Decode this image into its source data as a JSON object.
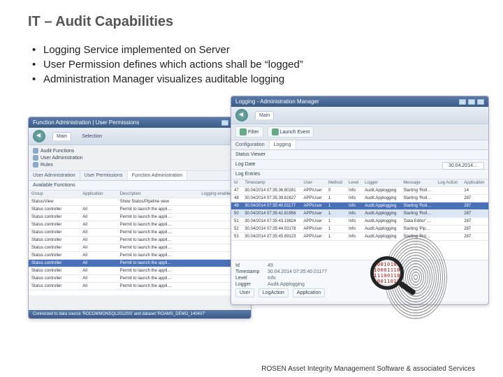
{
  "title": "IT – Audit Capabilities",
  "bullets": [
    "Logging Service implemented on Server",
    "User Permission defines which actions shall be “logged”",
    "Administration Manager visualizes auditable logging"
  ],
  "win1": {
    "title": "Function Administration | User Permissions",
    "ribbon": {
      "tab_main": "Main",
      "tab_selection": "Selection"
    },
    "side": [
      {
        "label": "Audit Functions"
      },
      {
        "label": "User Administration"
      },
      {
        "label": "Rules"
      }
    ],
    "subtabs": [
      "User Administration",
      "User Permissions",
      "Function Administration"
    ],
    "pane_label": "Available Functions",
    "columns": [
      "Group",
      "Application",
      "Description",
      "Logging enabled"
    ],
    "rows": [
      [
        "Status/View",
        "",
        "Show Status/Pipeline view",
        ""
      ],
      [
        "Status controller",
        "All",
        "Permit to launch the appli…",
        ""
      ],
      [
        "Status controller",
        "All",
        "Permit to launch the appli…",
        ""
      ],
      [
        "Status controller",
        "All",
        "Permit to launch the appli…",
        ""
      ],
      [
        "Status controller",
        "All",
        "Permit to launch the appli…",
        ""
      ],
      [
        "Status controller",
        "All",
        "Permit to launch the appli…",
        ""
      ],
      [
        "Status controller",
        "All",
        "Permit to launch the appli…",
        ""
      ],
      [
        "Status controller",
        "All",
        "Permit to launch the appli…",
        ""
      ],
      [
        "Status controller",
        "All",
        "Permit to launch the appli…",
        ""
      ],
      [
        "Status controller",
        "All",
        "Permit to launch the appli…",
        ""
      ],
      [
        "Status controller",
        "All",
        "Permit to launch the appli…",
        ""
      ],
      [
        "Status controller",
        "All",
        "Permit to launch the appli…",
        ""
      ]
    ],
    "sel_index": 8,
    "statusbar": "Connected to data source 'ROCOMMONSQL2012SS' and dataset 'ROAMS_DEMO_140407'"
  },
  "win2": {
    "title": "Logging - Administration Manager",
    "ribbon": {
      "tab_main": "Main"
    },
    "tool": {
      "filter": "Filter",
      "launch": "Launch Event",
      "configuration": "Configuration",
      "logging": "Logging"
    },
    "status_label": "Status Viewer",
    "date_label": "Log Date",
    "date_value": "30.04.2014…",
    "section_label": "Log Entries",
    "columns": [
      "Id",
      "Timestamp",
      "User",
      "Method",
      "Level",
      "Logger",
      "Message",
      "Log Action",
      "Application"
    ],
    "rows": [
      [
        "47",
        "30.04/2014 07:35:36.80281",
        "APP\\User",
        "0",
        "Info",
        "Audit.Applogging",
        "Starting 'Roll…",
        "",
        "14"
      ],
      [
        "48",
        "30.04/2014 07:35:39.82627",
        "APP\\User",
        "1",
        "Info",
        "Audit.Applogging",
        "Starting 'Roll…",
        "",
        "287"
      ],
      [
        "49",
        "30.04/2014 07:35:40.01177",
        "APP\\User",
        "1",
        "Info",
        "Audit.Applogging",
        "Starting 'Roll…",
        "",
        "287"
      ],
      [
        "50",
        "30.04/2014 07:35:42.81956",
        "APP\\User",
        "1",
        "Info",
        "Audit.Applogging",
        "Starting 'Roll…",
        "",
        "287"
      ],
      [
        "51",
        "30.04/2014 07:35:43.19824",
        "APP\\User",
        "1",
        "Info",
        "Audit.Applogging",
        "'Data Editor' …",
        "",
        "287"
      ],
      [
        "52",
        "30.04/2014 07:35:44.03178",
        "APP\\User",
        "1",
        "Info",
        "Audit.Applogging",
        "Starting 'Pip…",
        "",
        "287"
      ],
      [
        "53",
        "30.04/2014 07:35:45.89123",
        "APP\\User",
        "1",
        "Info",
        "Audit.Applogging",
        "Starting 'Rol…",
        "",
        "287"
      ]
    ],
    "sel_index": 2,
    "hl_index": 3,
    "filter": {
      "id_label": "Id",
      "id_val": "49",
      "ts_label": "Timestamp",
      "ts_val": "30.04.2014 07:35:40.01177",
      "user_label": "User",
      "level_label": "Level",
      "level_val": "Info",
      "logger_label": "Logger",
      "logger_val": "Audit.Applogging",
      "extra1": "LogAction",
      "extra2": "Application"
    }
  },
  "magnifier_binary": "10010100\n10001110\n11100110\n10011010",
  "footer": "ROSEN Asset Integrity Management Software & associated Services"
}
